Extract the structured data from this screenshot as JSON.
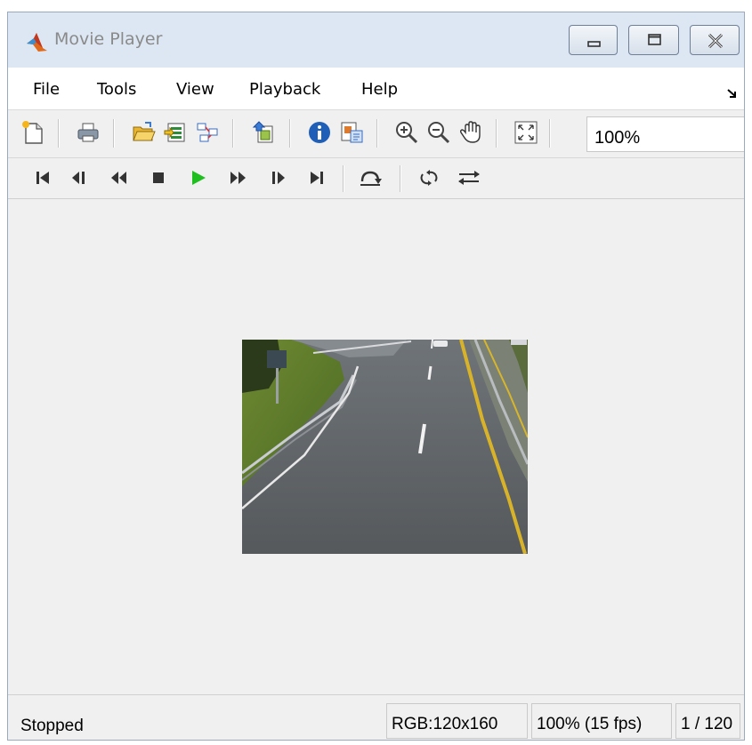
{
  "window": {
    "title": "Movie Player"
  },
  "menu": {
    "items": [
      {
        "label": "File"
      },
      {
        "label": "Tools"
      },
      {
        "label": "View"
      },
      {
        "label": "Playback"
      },
      {
        "label": "Help"
      }
    ]
  },
  "toolbar": {
    "zoom_value": "100%",
    "icons": [
      "new-file-icon",
      "print-icon",
      "open-folder-icon",
      "import-icon",
      "connect-icon",
      "export-icon",
      "info-icon",
      "properties-icon",
      "zoom-in-icon",
      "zoom-out-icon",
      "pan-hand-icon",
      "fit-view-icon"
    ]
  },
  "playback": {
    "icons": [
      "first-frame-icon",
      "step-back-icon",
      "rewind-icon",
      "stop-icon",
      "play-icon",
      "fast-forward-icon",
      "step-forward-icon",
      "last-frame-icon",
      "jump-to-icon",
      "loop-icon",
      "playback-direction-icon"
    ]
  },
  "status": {
    "state": "Stopped",
    "frame_info": "RGB:120x160",
    "zoom_fps": "100% (15 fps)",
    "frame_counter": "1 / 120"
  },
  "colors": {
    "titlebar": "#dde7f3",
    "play_green": "#1fbf1f",
    "chrome": "#f0f0f0"
  }
}
